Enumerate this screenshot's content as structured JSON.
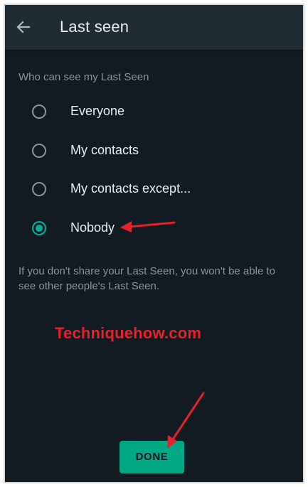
{
  "appbar": {
    "back_icon": "arrow-left-icon",
    "title": "Last seen"
  },
  "section_label": "Who can see my Last Seen",
  "options": [
    {
      "label": "Everyone",
      "selected": false
    },
    {
      "label": "My contacts",
      "selected": false
    },
    {
      "label": "My contacts except...",
      "selected": false
    },
    {
      "label": "Nobody",
      "selected": true
    }
  ],
  "footnote": "If you don't share your Last Seen, you won't be able to see other people's Last Seen.",
  "watermark": "Techniquehow.com",
  "done_button": {
    "label": "DONE"
  },
  "colors": {
    "background": "#121b22",
    "appbar": "#1f2c34",
    "accent": "#00a884",
    "radio_checked": "#00af9c",
    "annotation_arrow": "#e8202a"
  }
}
